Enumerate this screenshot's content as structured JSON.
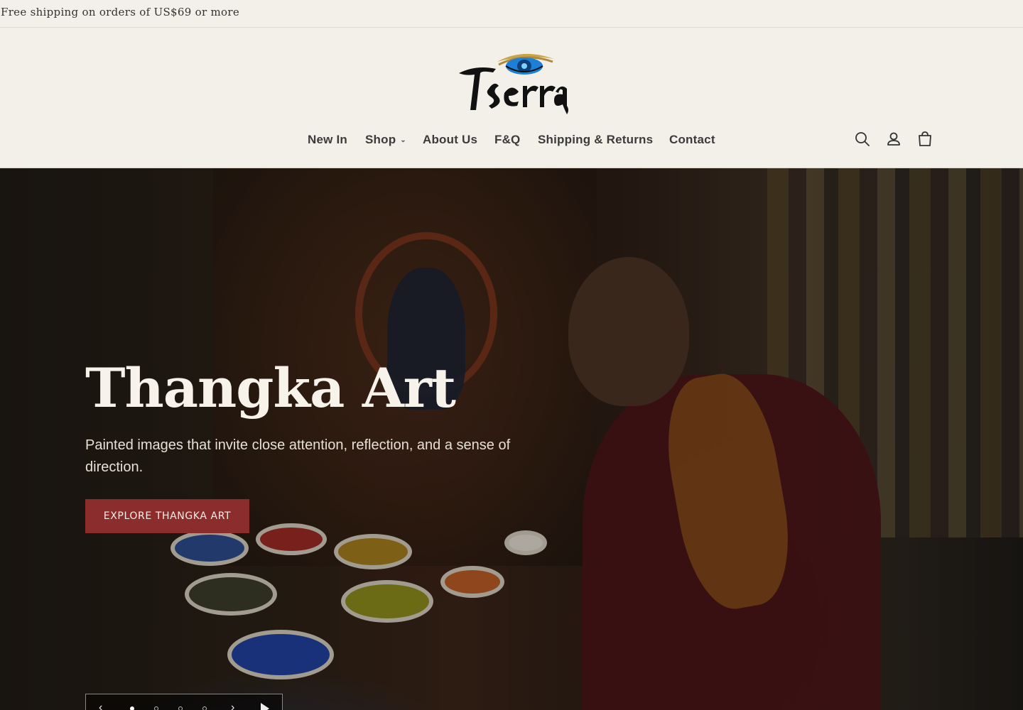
{
  "announcement": {
    "text": "Free shipping on orders of US$69 or more"
  },
  "header": {
    "logo_text": "Tserra",
    "nav": [
      {
        "label": "New In"
      },
      {
        "label": "Shop",
        "has_dropdown": true
      },
      {
        "label": "About Us"
      },
      {
        "label": "F&Q"
      },
      {
        "label": "Shipping & Returns"
      },
      {
        "label": "Contact"
      }
    ],
    "icons": [
      "search-icon",
      "account-icon",
      "cart-icon"
    ]
  },
  "hero": {
    "title": "Thangka Art",
    "subtitle": "Painted images that invite close attention, reflection, and a sense of direction.",
    "cta_label": "EXPLORE THANGKA ART",
    "slides_count": 4,
    "active_slide": 1,
    "prev_icon": "chevron-left-icon",
    "next_icon": "chevron-right-icon",
    "play_icon": "play-icon"
  },
  "colors": {
    "background": "#f3f0e9",
    "accent": "#8b2d2c",
    "nav_text": "#3b3b3b",
    "logo_eye": "#1e7fd6",
    "logo_brow": "#c9a44a"
  }
}
